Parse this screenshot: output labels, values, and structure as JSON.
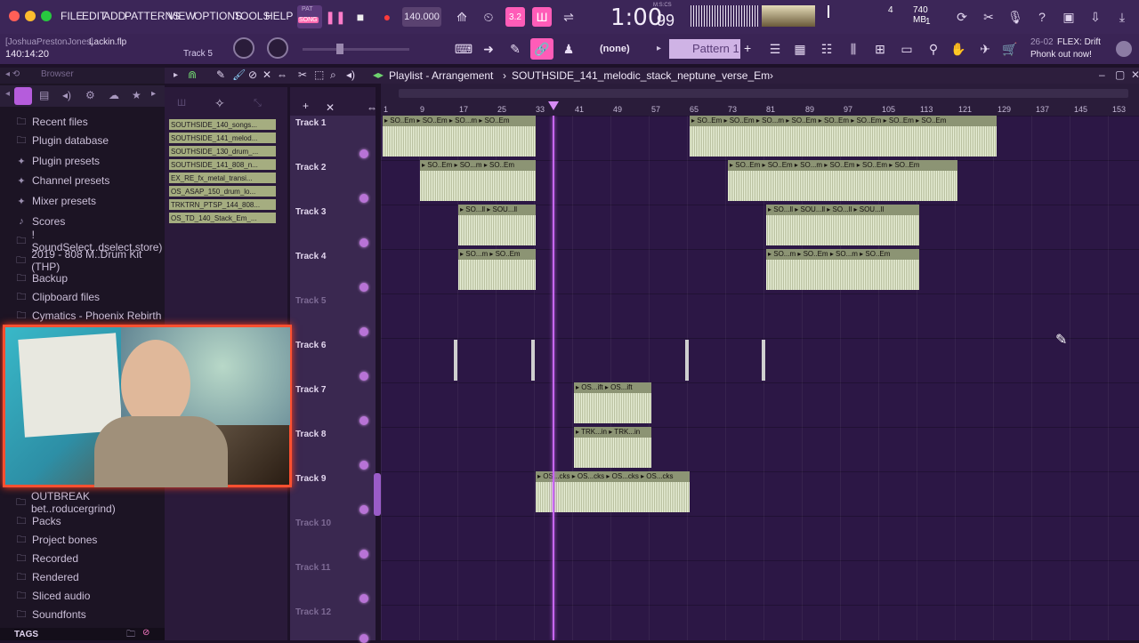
{
  "menu": {
    "items": [
      "FILE",
      "EDIT",
      "ADD",
      "PATTERNS",
      "VIEW",
      "OPTIONS",
      "TOOLS",
      "HELP"
    ],
    "pat_label": "PAT",
    "song_label": "SONG",
    "tempo": "140.000",
    "time_display": "1:00",
    "time_frac": "99",
    "time_unit": "M:S:CS",
    "memory": "740 MB",
    "cpu_count": "1",
    "voices": "4",
    "snap": "3.2"
  },
  "project": {
    "user": "[JoshuaPrestonJones]",
    "file": "Lackin.flp",
    "position": "140:14:20",
    "target": "Track 5"
  },
  "toolbar2": {
    "pattern_none": "(none)",
    "pattern_name": "Pattern 1",
    "news_date": "26-02",
    "news_title": "FLEX: Drift",
    "news_sub": "Phonk out now!"
  },
  "browser": {
    "title": "Browser",
    "items": [
      {
        "label": "Recent files",
        "icon": "folder-icon"
      },
      {
        "label": "Plugin database",
        "icon": "folder-icon"
      },
      {
        "label": "Plugin presets",
        "icon": "plugin-icon"
      },
      {
        "label": "Channel presets",
        "icon": "plugin-icon"
      },
      {
        "label": "Mixer presets",
        "icon": "plugin-icon"
      },
      {
        "label": "Scores",
        "icon": "note-icon"
      },
      {
        "label": "! SoundSelect..dselect.store)",
        "icon": "folder-icon"
      },
      {
        "label": "2019 - 808 M..Drum Kit (THP)",
        "icon": "folder-icon"
      },
      {
        "label": "Backup",
        "icon": "folder-icon"
      },
      {
        "label": "Clipboard files",
        "icon": "folder-icon"
      },
      {
        "label": "Cymatics - Phoenix Rebirth",
        "icon": "folder-icon"
      }
    ],
    "items_bottom": [
      {
        "label": "OUTBREAK bet..roducergrind)",
        "icon": "folder-icon"
      },
      {
        "label": "Packs",
        "icon": "folder-icon"
      },
      {
        "label": "Project bones",
        "icon": "folder-icon"
      },
      {
        "label": "Recorded",
        "icon": "folder-icon"
      },
      {
        "label": "Rendered",
        "icon": "folder-icon"
      },
      {
        "label": "Sliced audio",
        "icon": "folder-icon"
      },
      {
        "label": "Soundfonts",
        "icon": "folder-icon"
      }
    ],
    "tags_label": "TAGS"
  },
  "playlist": {
    "title": "Playlist - Arrangement",
    "separator": "›",
    "pattern": "SOUTHSIDE_141_melodic_stack_neptune_verse_Em",
    "ruler": [
      "1",
      "9",
      "17",
      "25",
      "33",
      "41",
      "49",
      "57",
      "65",
      "73",
      "81",
      "89",
      "97",
      "105",
      "113",
      "121",
      "129",
      "137",
      "145",
      "153"
    ]
  },
  "channels": [
    "SOUTHSIDE_140_songs...",
    "SOUTHSIDE_141_melod...",
    "SOUTHSIDE_130_drum_...",
    "SOUTHSIDE_141_808_n...",
    "EX_RE_fx_metal_transi...",
    "OS_ASAP_150_drum_lo...",
    "TRKTRN_PTSP_144_808...",
    "OS_TD_140_Stack_Em_..."
  ],
  "tracks": [
    "Track 1",
    "Track 2",
    "Track 3",
    "Track 4",
    "Track 5",
    "Track 6",
    "Track 7",
    "Track 8",
    "Track 9",
    "Track 10",
    "Track 11",
    "Track 12"
  ],
  "clips": {
    "t1": "▸ SO..Em ▸ SO..Em ▸ SO...m ▸ SO..Em",
    "t1b": "▸ SO..Em ▸ SO..Em ▸ SO...m ▸ SO..Em ▸ SO..Em ▸ SO..Em ▸ SO..Em ▸ SO..Em",
    "t2": "▸ SO..Em ▸ SO...m ▸ SO..Em",
    "t2b": "▸ SO..Em ▸ SO..Em ▸ SO...m ▸ SO..Em ▸ SO..Em ▸ SO..Em",
    "t3": "▸ SO...ll ▸ SOU...ll",
    "t3b": "▸ SO...ll ▸ SOU...ll ▸ SO...ll ▸ SOU...ll",
    "t4": "▸ SO...m ▸ SO..Em",
    "t4b": "▸ SO...m ▸ SO..Em ▸ SO...m ▸ SO..Em",
    "t7": "▸ OS...ift ▸ OS...ift",
    "t8": "▸ TRK...in ▸ TRK...in",
    "t9": "▸ OS...cks ▸ OS...cks ▸ OS...cks ▸ OS...cks"
  }
}
